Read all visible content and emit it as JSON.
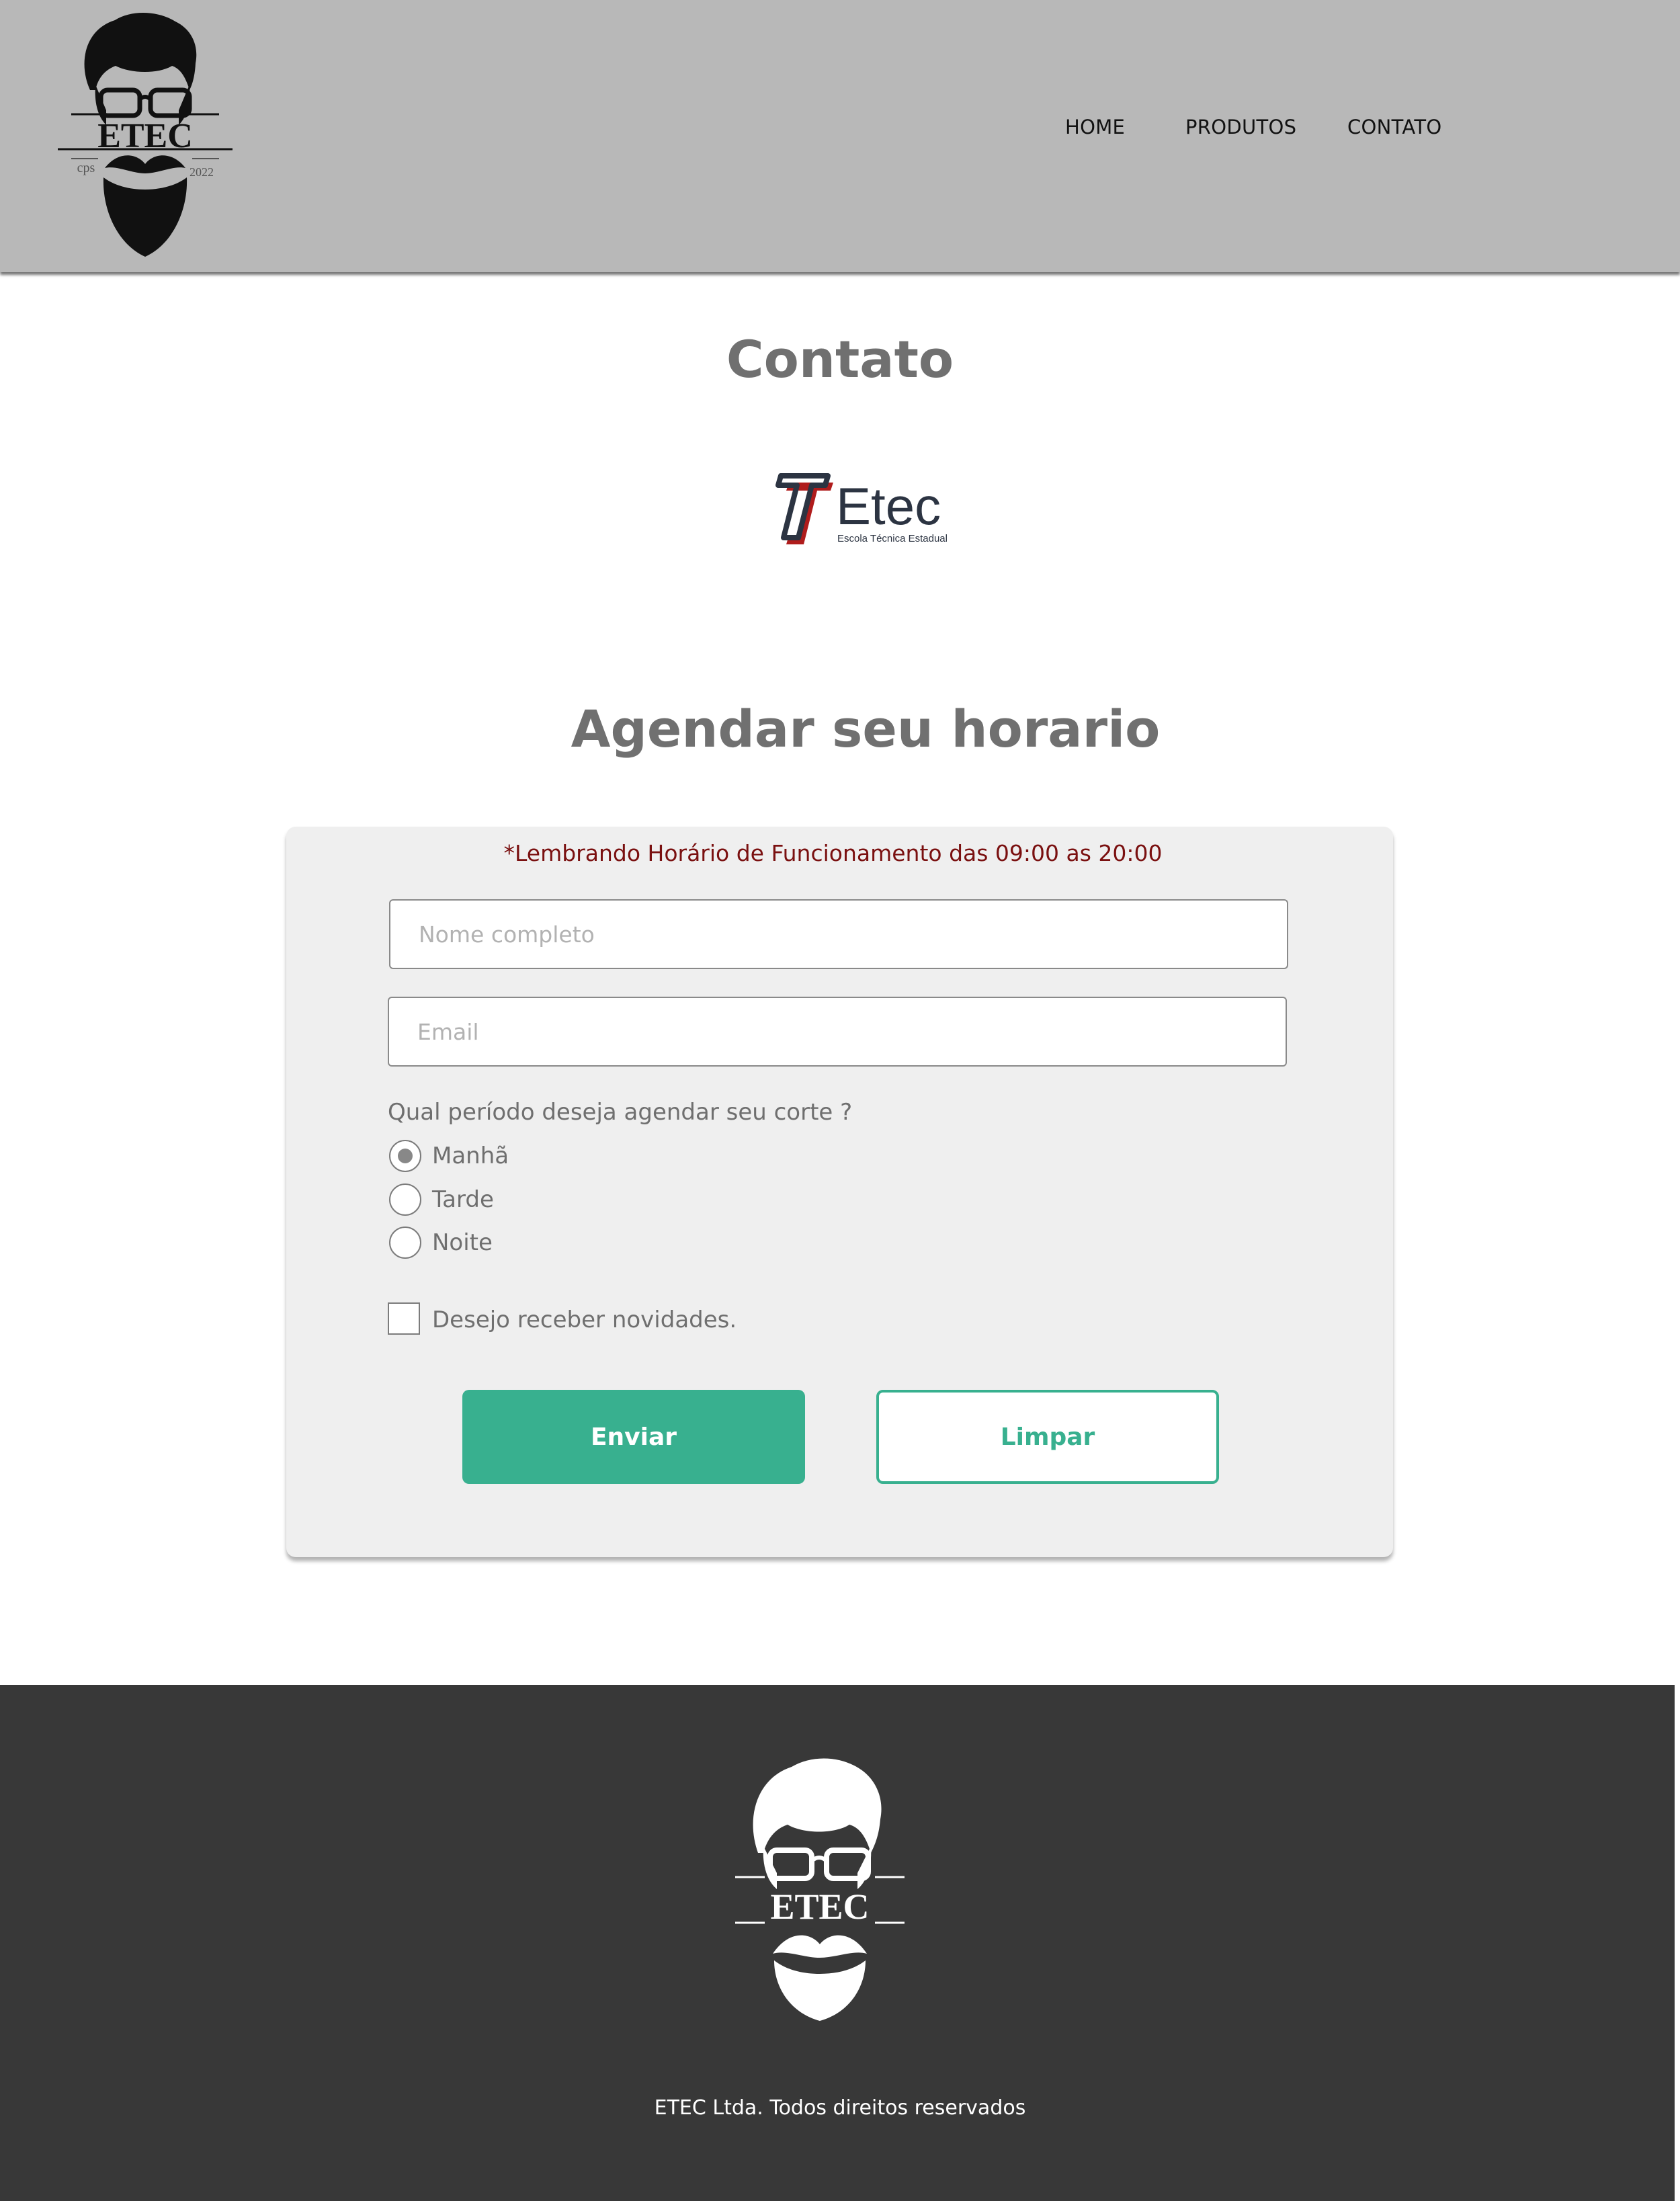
{
  "header": {
    "logo": {
      "icon": "barber-logo-icon",
      "text": "ETEC",
      "sub_left": "cps",
      "sub_right": "2022"
    },
    "nav": [
      {
        "label": "HOME"
      },
      {
        "label": "PRODUTOS"
      },
      {
        "label": "CONTATO"
      }
    ]
  },
  "main": {
    "title": "Contato",
    "etec_logo": {
      "icon": "etec-school-logo",
      "name": "Etec",
      "tagline": "Escola Técnica Estadual"
    },
    "section_title": "Agendar seu  horario",
    "form": {
      "notice": "*Lembrando Horário de Funcionamento das  09:00  as 20:00",
      "name_placeholder": "Nome completo",
      "email_placeholder": "Email",
      "question": "Qual período  deseja agendar seu corte ?",
      "periods": [
        {
          "label": "Manhã",
          "checked": true
        },
        {
          "label": "Tarde",
          "checked": false
        },
        {
          "label": "Noite",
          "checked": false
        }
      ],
      "newsletter_label": "Desejo receber novidades.",
      "newsletter_checked": false,
      "send_label": "Enviar",
      "clear_label": "Limpar"
    }
  },
  "footer": {
    "logo": {
      "icon": "barber-logo-icon",
      "text": "ETEC"
    },
    "copyright": "ETEC Ltda. Todos direitos reservados"
  },
  "colors": {
    "header_bg": "#b8b8b8",
    "footer_bg": "#383838",
    "accent": "#38b08f",
    "notice": "#7a1010",
    "card_bg": "#efefef"
  }
}
